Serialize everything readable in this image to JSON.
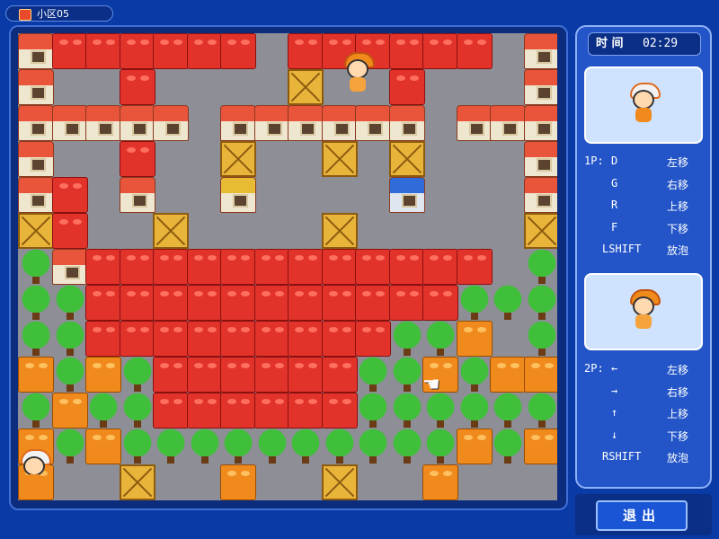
{
  "window": {
    "title": "小区05"
  },
  "timer": {
    "label": "时 间",
    "value": "02:29"
  },
  "controls": {
    "p1": {
      "player_label": "1P:",
      "rows": [
        {
          "key": "D",
          "action": "左移"
        },
        {
          "key": "G",
          "action": "右移"
        },
        {
          "key": "R",
          "action": "上移"
        },
        {
          "key": "F",
          "action": "下移"
        },
        {
          "key": "LSHIFT",
          "action": "放泡"
        }
      ]
    },
    "p2": {
      "player_label": "2P:",
      "rows": [
        {
          "key": "←",
          "action": "左移"
        },
        {
          "key": "→",
          "action": "右移"
        },
        {
          "key": "↑",
          "action": "上移"
        },
        {
          "key": "↓",
          "action": "下移"
        },
        {
          "key": "RSHIFT",
          "action": "放泡"
        }
      ]
    }
  },
  "exit_button": {
    "label": "退出"
  },
  "board": {
    "legend": {
      "B": "red-block",
      "O": "orange-block",
      "H": "house",
      "Y": "yellow-house",
      "U": "blue-house",
      "C": "wooden-crate",
      "T": "tree",
      ".": "floor"
    },
    "rows": [
      "HBBBBBB.BBBBBB.H",
      "H..B....C..B...H",
      "HHHHH.HHHHHH.HHH",
      "H..B..C..C.C...H",
      "HB.H..Y....U...H",
      "CB..C....C.....C",
      "THBBBBBBBBBBBB.T",
      "TTBBBBBBBBBBBTTT",
      "TTBBBBBBBBBTTO.T",
      "OTOTBBBBBBTTOTOO",
      "TOTTBBBBBBTTTTTT",
      "OTOTTTTTTTTTTOTO",
      "O..C..O..C..O..."
    ]
  },
  "players": [
    {
      "name": "1P",
      "color": "#f08a1c"
    },
    {
      "name": "2P",
      "color": "#f5a33c"
    }
  ]
}
